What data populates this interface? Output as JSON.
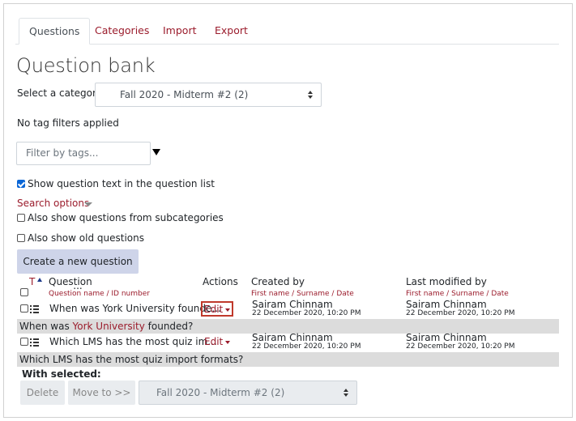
{
  "tabs": [
    {
      "label": "Questions",
      "active": true
    },
    {
      "label": "Categories",
      "active": false
    },
    {
      "label": "Import",
      "active": false
    },
    {
      "label": "Export",
      "active": false
    }
  ],
  "page_title": "Question bank",
  "category": {
    "label": "Select a category:",
    "selected": "Fall 2020 - Midterm #2 (2)"
  },
  "tag_status": "No tag filters applied",
  "tag_filter": {
    "placeholder": "Filter by tags..."
  },
  "show_question_text": {
    "label": "Show question text in the question list",
    "checked": true
  },
  "search_options": {
    "label": "Search options"
  },
  "subcategories": {
    "label": "Also show questions from subcategories",
    "checked": false
  },
  "old_questions": {
    "label": "Also show old questions",
    "checked": false
  },
  "create_button": "Create a new question ...",
  "table": {
    "columns": {
      "type": "T",
      "question": "Question",
      "question_sub": "Question name / ID number",
      "actions": "Actions",
      "created": "Created by",
      "created_sub": "First name / Surname / Date",
      "modified": "Last modified by",
      "modified_sub": "First name / Surname / Date"
    },
    "rows": [
      {
        "name": "When was York University founde...",
        "action": "Edit",
        "created_by": "Sairam Chinnam",
        "created_date": "22 December 2020, 10:20 PM",
        "modified_by": "Sairam Chinnam",
        "modified_date": "22 December 2020, 10:20 PM",
        "text_before": "When was ",
        "text_link": "York University",
        "text_after": " founded?"
      },
      {
        "name": "Which LMS has the most quiz im...",
        "action": "Edit",
        "created_by": "Sairam Chinnam",
        "created_date": "22 December 2020, 10:20 PM",
        "modified_by": "Sairam Chinnam",
        "modified_date": "22 December 2020, 10:20 PM",
        "text_full": "Which LMS has the most quiz import formats?"
      }
    ]
  },
  "with_selected": {
    "label": "With selected:",
    "delete": "Delete",
    "move": "Move to >>",
    "target": "Fall 2020 - Midterm #2 (2)"
  },
  "colors": {
    "link": "#9b1c2c",
    "accent_button": "#ced4e9",
    "highlight": "#c0392b"
  }
}
